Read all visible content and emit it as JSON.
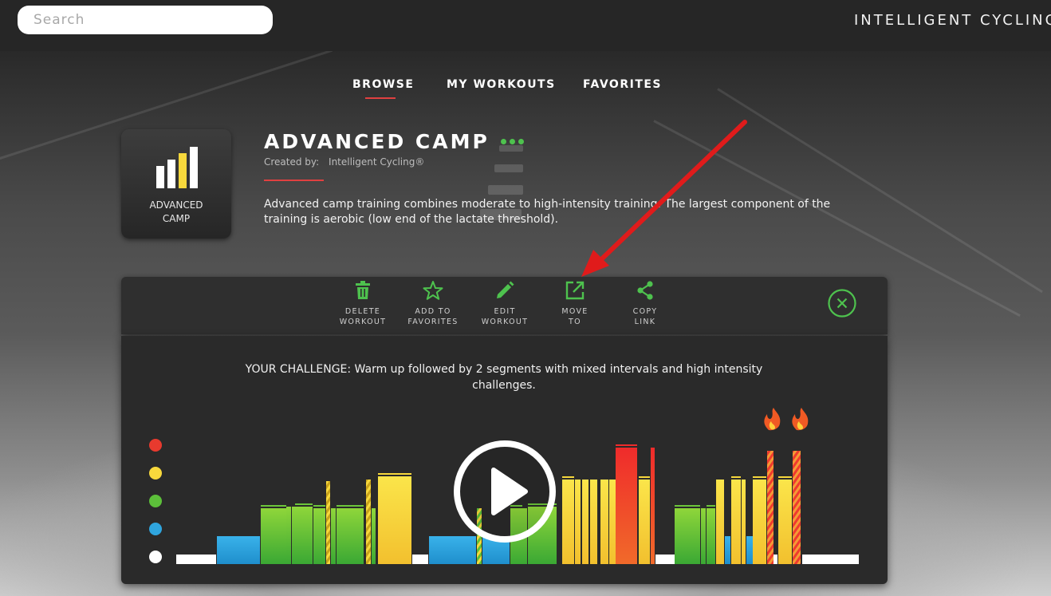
{
  "header": {
    "search_placeholder": "Search",
    "brand": "INTELLIGENT CYCLING®"
  },
  "nav": {
    "tabs": [
      {
        "label": "BROWSE",
        "active": true
      },
      {
        "label": "MY WORKOUTS",
        "active": false
      },
      {
        "label": "FAVORITES",
        "active": false
      }
    ]
  },
  "workout": {
    "tile_label_line1": "ADVANCED",
    "tile_label_line2": "CAMP",
    "title": "ADVANCED CAMP",
    "created_by_label": "Created by:",
    "created_by_value": "Intelligent Cycling®",
    "description": "Advanced camp training combines moderate to high-intensity training. The largest component of the training is aerobic (low end of the lactate threshold)."
  },
  "actions": [
    {
      "line1": "DELETE",
      "line2": "WORKOUT",
      "icon": "trash-icon"
    },
    {
      "line1": "ADD TO",
      "line2": "FAVORITES",
      "icon": "star-icon"
    },
    {
      "line1": "EDIT",
      "line2": "WORKOUT",
      "icon": "pencil-icon"
    },
    {
      "line1": "MOVE",
      "line2": "TO",
      "icon": "external-link-icon"
    },
    {
      "line1": "COPY",
      "line2": "LINK",
      "icon": "share-icon"
    }
  ],
  "challenge": {
    "text": "YOUR CHALLENGE:  Warm up followed by 2 segments with mixed intervals and high intensity challenges."
  },
  "colors": {
    "accent_green": "#4ec24e",
    "nav_underline": "#e04040",
    "zone_red": "#e83a2e",
    "zone_yellow": "#f7d83c",
    "zone_green": "#5cbf3a",
    "zone_blue": "#2fa5de",
    "zone_white": "#ffffff",
    "annotation_arrow": "#e01b1b"
  },
  "zones": [
    "red",
    "yellow",
    "green",
    "blue",
    "white"
  ]
}
